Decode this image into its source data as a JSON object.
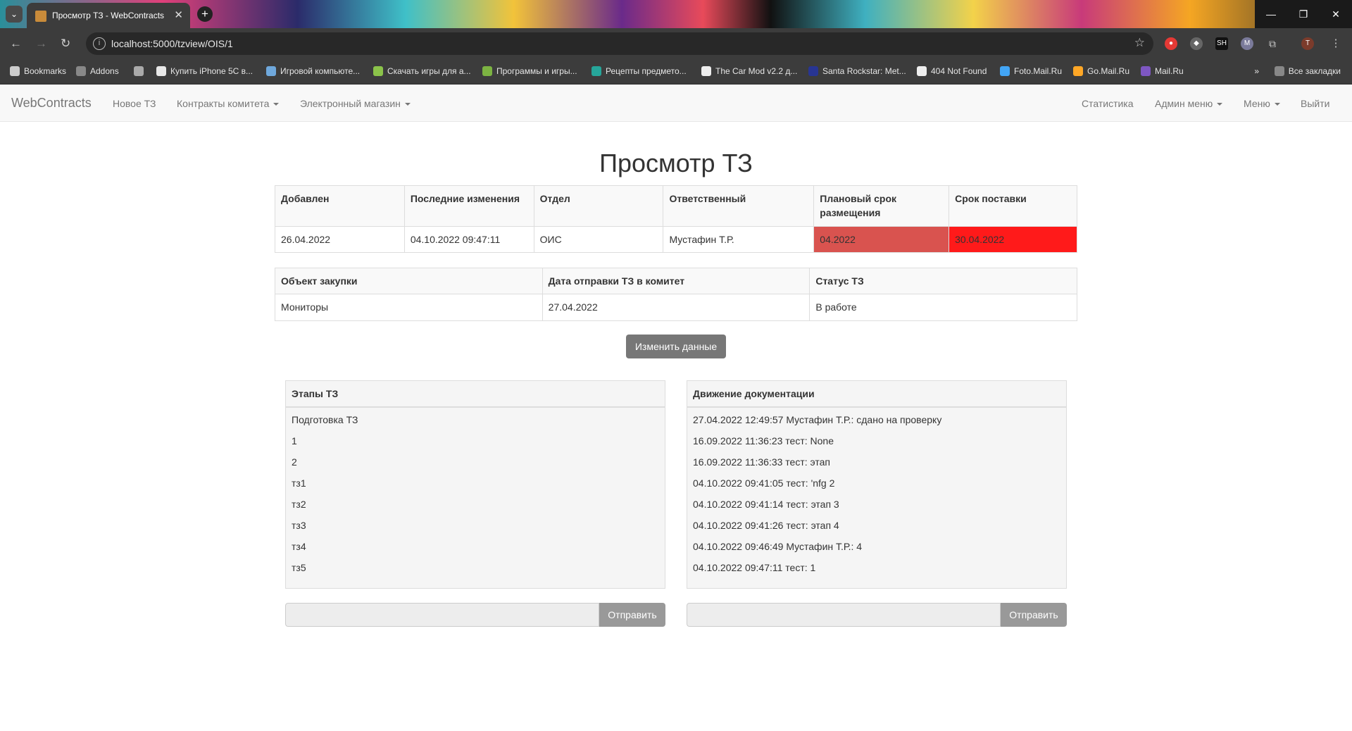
{
  "browser": {
    "tab_title": "Просмотр ТЗ - WebContracts",
    "url": "localhost:5000/tzview/OIS/1",
    "bookmarks": [
      {
        "label": "Bookmarks",
        "color": "#cccccc"
      },
      {
        "label": "Addons",
        "color": "#888888"
      },
      {
        "label": "",
        "color": "#aaaaaa"
      },
      {
        "label": "Купить iPhone 5C в...",
        "color": "#e8e8e8"
      },
      {
        "label": "Игровой компьюте...",
        "color": "#6fa8dc"
      },
      {
        "label": "Скачать игры для а...",
        "color": "#8bc34a"
      },
      {
        "label": "Программы и игры...",
        "color": "#7cb342"
      },
      {
        "label": "Рецепты предмето...",
        "color": "#26a69a"
      },
      {
        "label": "The Car Mod v2.2 д...",
        "color": "#eeeeee"
      },
      {
        "label": "Santa Rockstar: Met...",
        "color": "#283593"
      },
      {
        "label": "404 Not Found",
        "color": "#eeeeee"
      },
      {
        "label": "Foto.Mail.Ru",
        "color": "#42a5f5"
      },
      {
        "label": "Go.Mail.Ru",
        "color": "#ffa726"
      },
      {
        "label": "Mail.Ru",
        "color": "#7e57c2"
      }
    ],
    "all_bookmarks": "Все закладки"
  },
  "navbar": {
    "brand": "WebContracts",
    "left": [
      {
        "label": "Новое ТЗ",
        "dropdown": false
      },
      {
        "label": "Контракты комитета",
        "dropdown": true
      },
      {
        "label": "Электронный магазин",
        "dropdown": true
      }
    ],
    "right": [
      {
        "label": "Статистика",
        "dropdown": false
      },
      {
        "label": "Админ меню",
        "dropdown": true
      },
      {
        "label": "Меню",
        "dropdown": true
      },
      {
        "label": "Выйти",
        "dropdown": false
      }
    ]
  },
  "title": "Просмотр ТЗ",
  "info_table": {
    "headers": [
      "Добавлен",
      "Последние изменения",
      "Отдел",
      "Ответственный",
      "Плановый срок размещения",
      "Срок поставки"
    ],
    "row": [
      "26.04.2022",
      "04.10.2022 09:47:11",
      "ОИС",
      "Мустафин Т.Р.",
      "04.2022",
      "30.04.2022"
    ],
    "highlight": {
      "planned_bg": "#d9534f",
      "delivery_bg": "#ff1a1a"
    }
  },
  "object_table": {
    "headers": [
      "Объект закупки",
      "Дата отправки ТЗ в комитет",
      "Статус ТЗ"
    ],
    "row": [
      "Мониторы",
      "27.04.2022",
      "В работе"
    ]
  },
  "edit_button": "Изменить данные",
  "stages": {
    "title": "Этапы ТЗ",
    "items": [
      "Подготовка ТЗ",
      "1",
      "2",
      "тз1",
      "тз2",
      "тз3",
      "тз4",
      "тз5"
    ],
    "send_label": "Отправить"
  },
  "docs": {
    "title": "Движение документации",
    "items": [
      "27.04.2022 12:49:57 Мустафин Т.Р.: сдано на проверку",
      "16.09.2022 11:36:23 тест: None",
      "16.09.2022 11:36:33 тест: этап",
      "04.10.2022 09:41:05 тест: 'nfg 2",
      "04.10.2022 09:41:14 тест: этап 3",
      "04.10.2022 09:41:26 тест: этап 4",
      "04.10.2022 09:46:49 Мустафин Т.Р.: 4",
      "04.10.2022 09:47:11 тест: 1"
    ],
    "send_label": "Отправить"
  }
}
